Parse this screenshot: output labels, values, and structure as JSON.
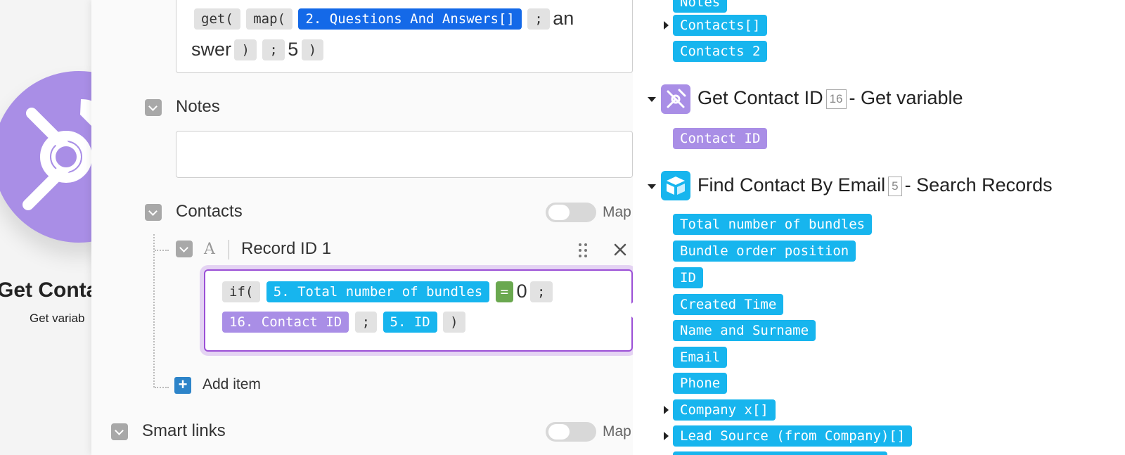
{
  "background_module": {
    "title": "Get Conta",
    "subtitle": "Get variab",
    "color": "#a98ee6"
  },
  "panel": {
    "top_field": {
      "line1": [
        {
          "t": "get(",
          "kind": "fn"
        },
        {
          "t": "map(",
          "kind": "fn"
        },
        {
          "t": "2. Questions And Answers[]",
          "kind": "blue"
        },
        {
          "t": ";",
          "kind": "fn"
        },
        {
          "t": "an",
          "kind": "plain"
        }
      ],
      "line2": [
        {
          "t": "swer",
          "kind": "plain"
        },
        {
          "t": ")",
          "kind": "fn"
        },
        {
          "t": ";",
          "kind": "fn"
        },
        {
          "t": "5",
          "kind": "plain"
        },
        {
          "t": ")",
          "kind": "fn"
        }
      ]
    },
    "notes_label": "Notes",
    "notes_value": "",
    "contacts_label": "Contacts",
    "map_label": "Map",
    "record": {
      "label": "Record ID 1",
      "type_icon": "A",
      "line1": [
        {
          "t": "if(",
          "kind": "fn"
        },
        {
          "t": "5. Total number of bundles",
          "kind": "cyan"
        },
        {
          "t": "=",
          "kind": "green"
        },
        {
          "t": "0",
          "kind": "plain"
        },
        {
          "t": ";",
          "kind": "fn"
        }
      ],
      "line2": [
        {
          "t": "16. Contact ID",
          "kind": "purple"
        },
        {
          "t": ";",
          "kind": "fn"
        },
        {
          "t": "5. ID",
          "kind": "cyan"
        },
        {
          "t": ")",
          "kind": "fn"
        }
      ]
    },
    "add_item_label": "Add item",
    "smart_links_label": "Smart links"
  },
  "mapping": {
    "top_items": [
      {
        "label": "Notes",
        "expandable": false
      },
      {
        "label": "Contacts[]",
        "expandable": true
      },
      {
        "label": "Contacts 2",
        "expandable": false
      }
    ],
    "get_contact": {
      "title": "Get Contact ID",
      "badge": "16",
      "suffix": "- Get variable",
      "items": [
        {
          "label": "Contact ID",
          "expandable": false
        }
      ]
    },
    "find_contact": {
      "title": "Find Contact By Email",
      "badge": "5",
      "suffix": "- Search Records",
      "items": [
        {
          "label": "Total number of bundles",
          "expandable": false
        },
        {
          "label": "Bundle order position",
          "expandable": false
        },
        {
          "label": "ID",
          "expandable": false
        },
        {
          "label": "Created Time",
          "expandable": false
        },
        {
          "label": "Name and Surname",
          "expandable": false
        },
        {
          "label": "Email",
          "expandable": false
        },
        {
          "label": "Phone",
          "expandable": false
        },
        {
          "label": "Company x[]",
          "expandable": true
        },
        {
          "label": "Lead Source (from Company)[]",
          "expandable": true
        },
        {
          "label": "",
          "expandable": false
        }
      ]
    }
  },
  "colors": {
    "cyan": "#17b5ee",
    "blue": "#1469e8",
    "purple": "#a98ee6",
    "green": "#6aa84f",
    "airtable": "#17b5ee"
  }
}
